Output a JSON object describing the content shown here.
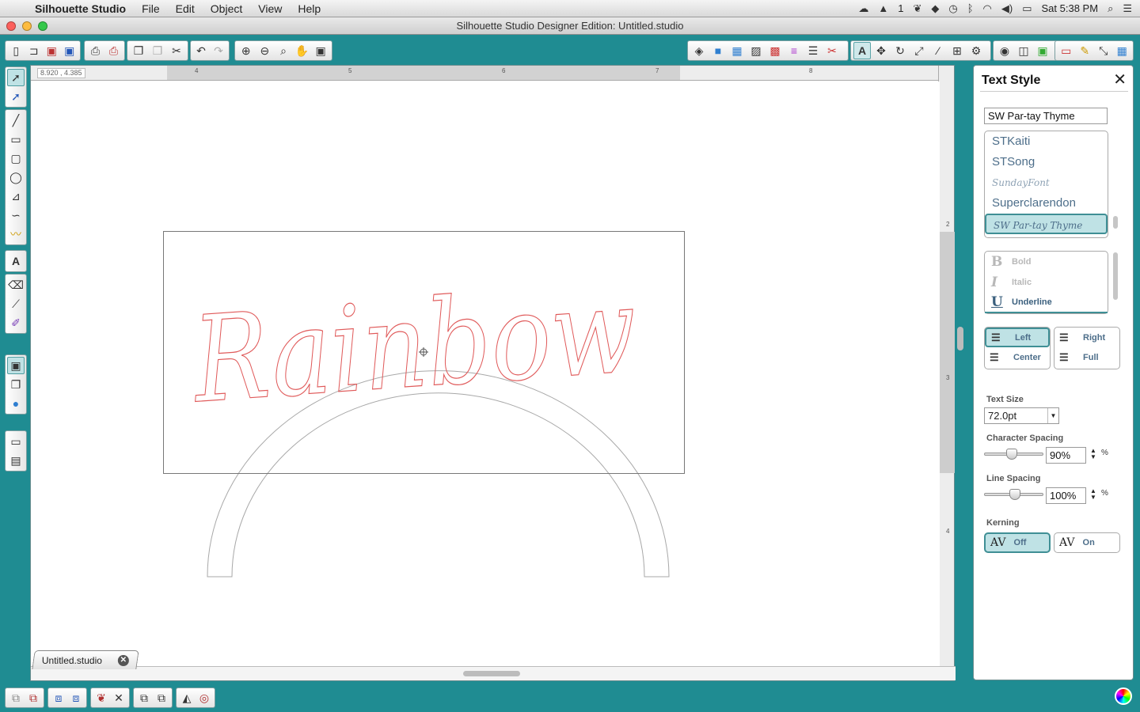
{
  "menubar": {
    "app_name": "Silhouette Studio",
    "menus": [
      "File",
      "Edit",
      "Object",
      "View",
      "Help"
    ],
    "status_badge": "1",
    "clock": "Sat 5:38 PM"
  },
  "window": {
    "title": "Silhouette Studio Designer Edition: Untitled.studio"
  },
  "canvas": {
    "coord_readout": "8.920 , 4.385",
    "ruler_top_labels": [
      "4",
      "5",
      "6",
      "7",
      "8"
    ],
    "ruler_left_labels": [
      "2",
      "3",
      "4"
    ],
    "design_text": "Rainbow",
    "design_text_color": "#e05a5a",
    "arch_color": "#a8a8a8"
  },
  "document_tab": {
    "name": "Untitled.studio",
    "close_glyph": "✕"
  },
  "text_style_panel": {
    "title": "Text Style",
    "close_glyph": "✕",
    "font_name": "SW Par-tay Thyme",
    "font_list": [
      {
        "label": "STKaiti",
        "kind": "normal"
      },
      {
        "label": "STSong",
        "kind": "normal"
      },
      {
        "label": "SundayFont",
        "kind": "script"
      },
      {
        "label": "Superclarendon",
        "kind": "normal"
      },
      {
        "label": "SW Par-tay Thyme",
        "kind": "selected"
      }
    ],
    "styles": [
      {
        "glyph": "B",
        "label": "Bold"
      },
      {
        "glyph": "I",
        "label": "Italic"
      },
      {
        "glyph": "U",
        "label": "Underline"
      }
    ],
    "alignment": {
      "left": "Left",
      "center": "Center",
      "right": "Right",
      "full": "Full",
      "selected": "Left"
    },
    "text_size_label": "Text Size",
    "text_size_value": "72.0pt",
    "char_spacing_label": "Character Spacing",
    "char_spacing_value": "90%",
    "char_spacing_fraction": 0.45,
    "line_spacing_label": "Line Spacing",
    "line_spacing_value": "100%",
    "line_spacing_fraction": 0.5,
    "percent_symbol": "%",
    "kerning_label": "Kerning",
    "kerning_glyph": "AV",
    "kerning_off": "Off",
    "kerning_on": "On",
    "kerning_selected": "Off"
  },
  "colors": {
    "teal_bg": "#1f8c92",
    "selection_fill": "#bfe2e5",
    "selection_border": "#3f8f95"
  }
}
